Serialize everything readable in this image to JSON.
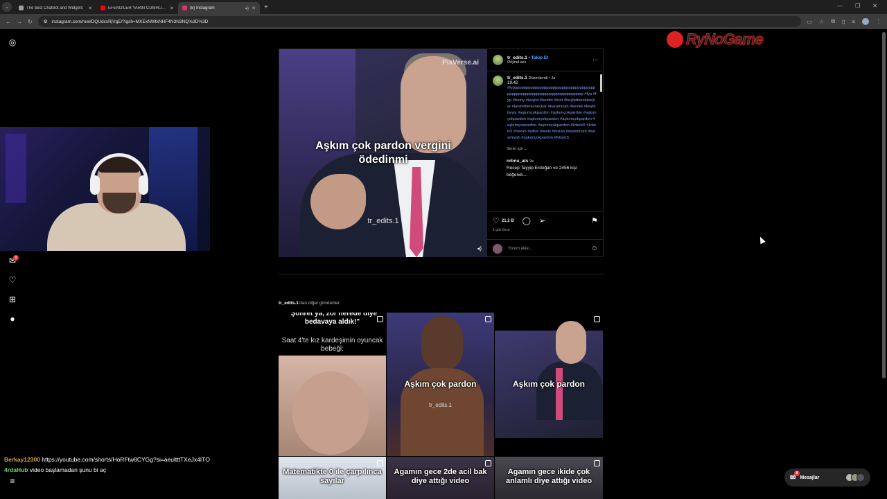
{
  "browser": {
    "tabs": [
      {
        "title": "The best ChatBot and Widgets",
        "color": "#9aa0a6",
        "active": false
      },
      {
        "title": "EFENDİLER YARIN CUMHURİYE",
        "color": "#ff0000",
        "active": false
      },
      {
        "title": "(8) Instagram",
        "color": "#e1306c",
        "active": true
      }
    ],
    "url": "instagram.com/reel/DQUdxsRjVgE/?igsh=MXExNWtkNHF4N3N3NQ%3D%3D"
  },
  "post": {
    "video_caption": "Aşkım çok pardon vergini ödedinmi",
    "watermark": "tr_edits.1",
    "pixverse": "PixVerse.ai",
    "username": "tr_edits.1",
    "separator": "•",
    "follow_label": "Takip Et",
    "audio": "Orijinal ses",
    "edited": "Düzenlendi",
    "edited_time": "3s",
    "caption_number": "19.42",
    "hashtags": "#fyppppppppppppppppppppppppppppppppppppppppppppppppppppppppppppppppppppppp #fyp #fyp #funny #keşfet #kesfet #kürt #keşfetbeniöneçkar #kesfetbenioneçkar #karamizah #kesfet #keşfetteyiz #aşkımçokpardon #aşkımçokpardon #aşkımçokpardon #aşkımçokpardon #aşkımçokpardon #aşkımçokpardon #aşkımçokpardon #lvbelc5 #lvbelc5 #mizah #silivri #reels #mizah #darkmizah #karamizah #aşkımçokpardon #lvbelc5",
    "for_you": "Senin için",
    "comment_user": "nrbnu_ats",
    "comment_time": "9s",
    "comment_text": "Recep Tayyip Erdoğan ve 2456 kişi beğendi....",
    "likes": "21,2 B",
    "time_ago": "1 gün önce",
    "comment_placeholder": "Yorum ekle..."
  },
  "more_posts": {
    "username": "tr_edits.1",
    "suffix": "'dan diğer gönderiler",
    "tiles": [
      {
        "top": "\"Şöhret ya, zor nerede diye bedavaya aldık!\"",
        "mid": "Saat 4'te kız kardeşimin oyuncak bebeği:"
      },
      {
        "caption": "Aşkım çok pardon",
        "wm": "tr_edits.1"
      },
      {
        "caption": "Aşkım çok pardon"
      },
      {
        "caption": "Matematikte 0 ile çarpılınca sayılar"
      },
      {
        "caption": "Agamın gece 2de acil bak diye attığı video"
      },
      {
        "caption": "Agamın gece ikide çok anlamlı diye attığı video"
      }
    ]
  },
  "sidebar": {
    "notif_count": "8"
  },
  "overlay": {
    "logo": "RyNoGame",
    "chat": [
      {
        "user": "Berkay12300",
        "msg": "https://youtube.com/shorts/HoRFtw8CYGg?si=aeultttTXeJx4ITO"
      },
      {
        "user": "4rdaHub",
        "msg": "video başlamadan şunu bi aç"
      }
    ]
  },
  "messages": {
    "label": "Mesajlar",
    "badge": "8"
  }
}
